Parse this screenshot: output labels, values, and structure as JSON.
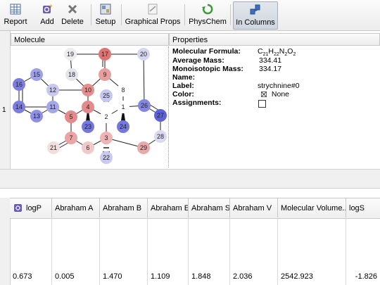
{
  "toolbar": {
    "report_label": "Report",
    "add_label": "Add",
    "delete_label": "Delete",
    "setup_label": "Setup",
    "graphical_props_label": "Graphical Props",
    "physchem_label": "PhysChem",
    "in_columns_label": "In Columns"
  },
  "upper": {
    "row_number": "1",
    "molecule_header": "Molecule",
    "properties_header": "Properties"
  },
  "properties": {
    "formula_label": "Molecular Formula:",
    "formula_c": "C",
    "formula_c_n": "21",
    "formula_h": "H",
    "formula_h_n": "22",
    "formula_n": "N",
    "formula_n_n": "2",
    "formula_o": "O",
    "formula_o_n": "2",
    "avg_mass_label": "Average Mass:",
    "avg_mass_value": "334.41",
    "mono_mass_label": "Monoisotopic Mass:",
    "mono_mass_value": "334.17",
    "name_label": "Name:",
    "name_value": "",
    "label_label": "Label:",
    "label_value": "strychnine#0",
    "color_label": "Color:",
    "color_value": "None",
    "assignments_label": "Assignments:"
  },
  "molecule": {
    "atoms": [
      "1",
      "2",
      "3",
      "4",
      "5",
      "6",
      "7",
      "8",
      "9",
      "10",
      "11",
      "12",
      "13",
      "14",
      "15",
      "16",
      "17",
      "18",
      "19",
      "20",
      "21",
      "22",
      "23",
      "24",
      "25",
      "26",
      "27",
      "28",
      "29"
    ]
  },
  "table": {
    "headers": [
      "logP",
      "Abraham A",
      "Abraham B",
      "Abraham E",
      "Abraham S",
      "Abraham V",
      "Molecular Volume...",
      "logS"
    ],
    "values": [
      "0.673",
      "0.005",
      "1.470",
      "1.109",
      "1.848",
      "2.036",
      "2542.923",
      "-1.826"
    ]
  },
  "colors": {
    "atom_blue": "#6a6ee0",
    "atom_red": "#e07272",
    "atom_light_red": "#efb3b3",
    "atom_light_blue": "#c7c8ee",
    "atom_grey": "#dcdce6",
    "accent_active": "#cfd6df"
  }
}
